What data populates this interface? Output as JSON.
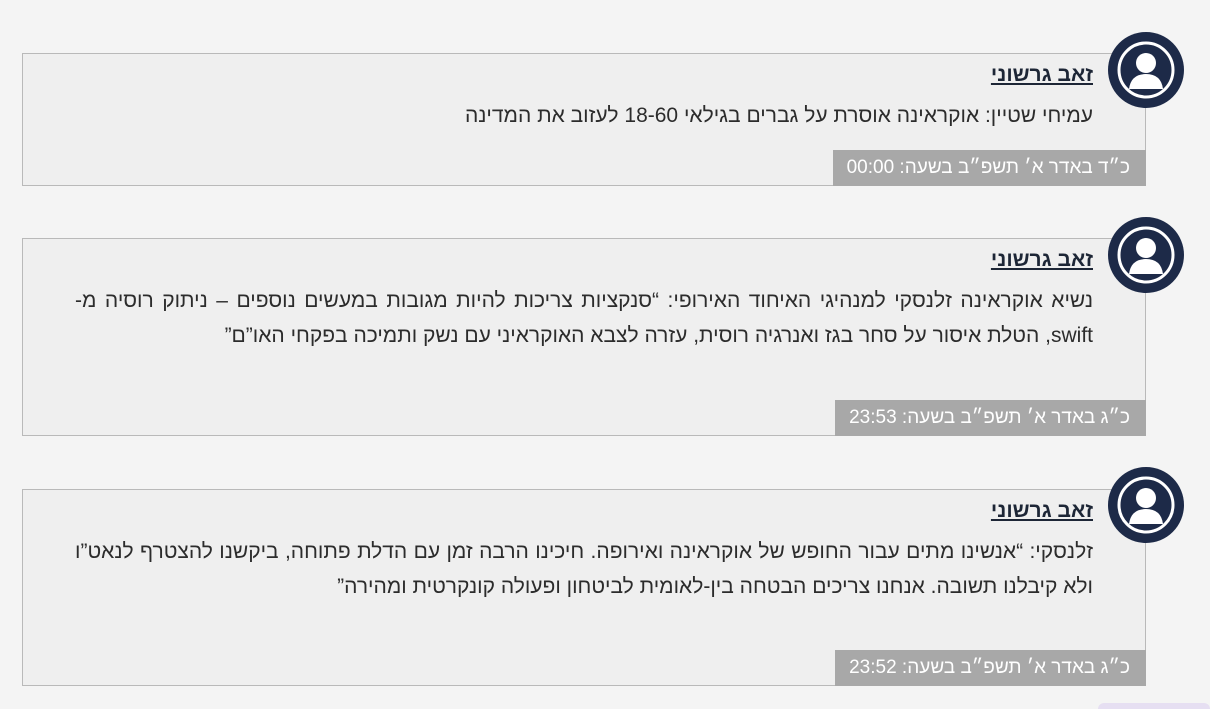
{
  "posts": [
    {
      "author": "זאב גרשוני",
      "text": "עמיחי שטיין: אוקראינה אוסרת על גברים בגילאי 18-60 לעזוב את המדינה",
      "timestamp": "כ״ד באדר א׳ תשפ״ב בשעה: 00:00"
    },
    {
      "author": "זאב גרשוני",
      "text": "נשיא אוקראינה זלנסקי למנהיגי האיחוד האירופי: “סנקציות צריכות להיות מגובות במעשים נוספים – ניתוק רוסיה מ-swift, הטלת איסור על סחר בגז ואנרגיה רוסית, עזרה לצבא האוקראיני עם נשק ותמיכה בפקחי האו”ם”",
      "timestamp": "כ״ג באדר א׳ תשפ״ב בשעה: 23:53"
    },
    {
      "author": "זאב גרשוני",
      "text": "זלנסקי: “אנשינו מתים עבור החופש של אוקראינה ואירופה. חיכינו הרבה זמן עם הדלת פתוחה, ביקשנו להצטרף לנאט”ו ולא קיבלנו תשובה. אנחנו צריכים הבטחה בין-לאומית לביטחון ופעולה קונקרטית ומהירה”",
      "timestamp": "כ״ג באדר א׳ תשפ״ב בשעה: 23:52"
    }
  ],
  "icons": {
    "avatar": "user-avatar-icon"
  },
  "colors": {
    "avatar_bg": "#1d2a48",
    "timestamp_bg": "#a8a8a8",
    "card_bg": "#efefef",
    "author": "#1d2636"
  }
}
